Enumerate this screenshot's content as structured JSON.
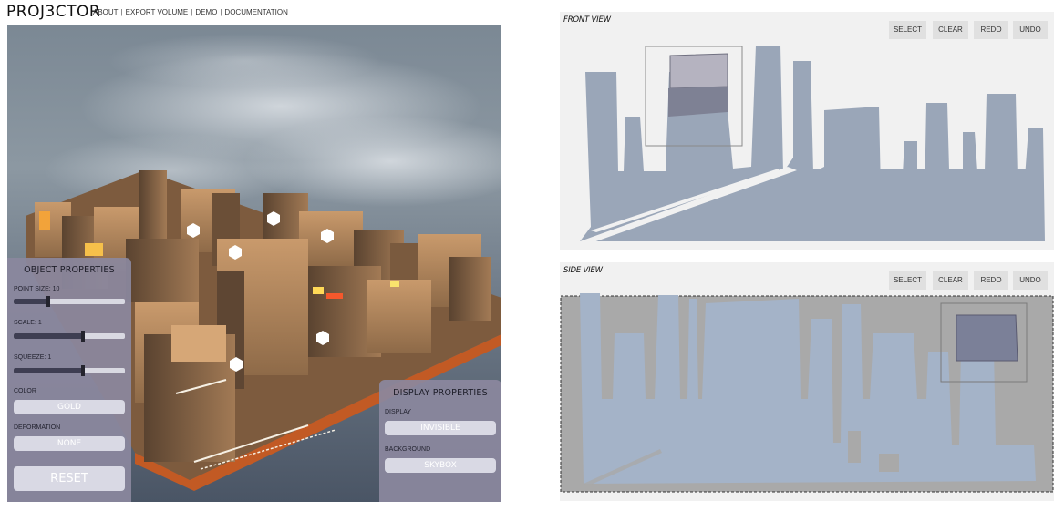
{
  "header": {
    "brand": "PROJ3CTOR",
    "nav": [
      "ABOUT",
      "EXPORT VOLUME",
      "DEMO",
      "DOCUMENTATION"
    ],
    "separator": "|"
  },
  "object_panel": {
    "title": "OBJECT PROPERTIES",
    "point_size_label": "POINT SIZE: 10",
    "point_size_level": 0.31,
    "scale_label": "SCALE: 1",
    "scale_level": 0.62,
    "squeeze_label": "SQUEEZE: 1",
    "squeeze_level": 0.62,
    "color_label": "COLOR",
    "color_value": "GOLD",
    "deformation_label": "DEFORMATION",
    "deformation_value": "NONE",
    "reset_label": "RESET"
  },
  "display_panel": {
    "title": "DISPLAY PROPERTIES",
    "display_label": "DISPLAY",
    "display_value": "INVISIBLE",
    "background_label": "BACKGROUND",
    "background_value": "SKYBOX"
  },
  "front_view": {
    "title": "FRONT VIEW",
    "buttons": [
      "SELECT",
      "CLEAR",
      "REDO",
      "UNDO"
    ]
  },
  "side_view": {
    "title": "SIDE VIEW",
    "buttons": [
      "SELECT",
      "CLEAR",
      "REDO",
      "UNDO"
    ]
  },
  "colors": {
    "panel": "#8b889e",
    "silhouette": "#9aa6b8",
    "view_bg": "#f1f1f1",
    "side_bg": "#a9a9a9",
    "object": "gold"
  }
}
